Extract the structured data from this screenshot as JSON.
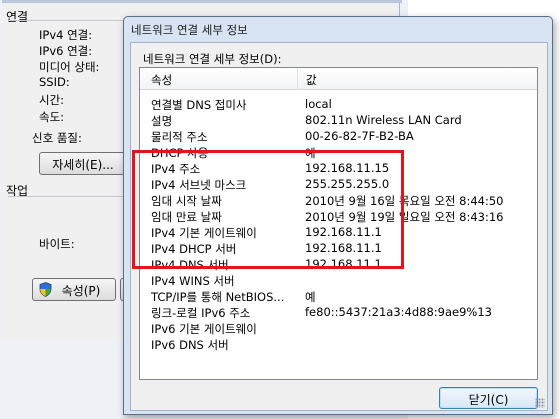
{
  "status_window": {
    "section_connection": "연결",
    "ipv4_label": "IPv4 연결:",
    "ipv6_label": "IPv6 연결:",
    "media_label": "미디어 상태:",
    "ssid_label": "SSID:",
    "time_label": "시간:",
    "speed_label": "속도:",
    "quality_label": "신호 품질:",
    "details_button": "자세히(E)...",
    "section_activity": "작업",
    "bytes_label": "바이트:",
    "properties_button": "속성(P)"
  },
  "dialog": {
    "title": "네트워크 연결 세부 정보",
    "caption": "네트워크 연결 세부 정보(D):",
    "header_property": "속성",
    "header_value": "값",
    "rows": [
      {
        "property": "연결별 DNS 접미사",
        "value": "local"
      },
      {
        "property": "설명",
        "value": "802.11n Wireless LAN Card"
      },
      {
        "property": "물리적 주소",
        "value": "00-26-82-7F-B2-BA"
      },
      {
        "property": "DHCP 사용",
        "value": "예"
      },
      {
        "property": "IPv4 주소",
        "value": "192.168.11.15"
      },
      {
        "property": "IPv4 서브넷 마스크",
        "value": "255.255.255.0"
      },
      {
        "property": "임대 시작 날짜",
        "value": "2010년 9월 16일 목요일 오전 8:44:50"
      },
      {
        "property": "임대 만료 날짜",
        "value": "2010년 9월 19일 일요일 오전 8:43:16"
      },
      {
        "property": "IPv4 기본 게이트웨이",
        "value": "192.168.11.1"
      },
      {
        "property": "IPv4 DHCP 서버",
        "value": "192.168.11.1"
      },
      {
        "property": "IPv4 DNS 서버",
        "value": "192.168.11.1"
      },
      {
        "property": "IPv4 WINS 서버",
        "value": ""
      },
      {
        "property": "TCP/IP를 통해 NetBIOS...",
        "value": "예"
      },
      {
        "property": "링크-로컬 IPv6 주소",
        "value": "fe80::5437:21a3:4d88:9ae9%13"
      },
      {
        "property": "IPv6 기본 게이트웨이",
        "value": ""
      },
      {
        "property": "IPv6 DNS 서버",
        "value": ""
      }
    ],
    "close_button": "닫기(C)"
  },
  "colors": {
    "highlight": "#e2141c",
    "dialog_frame": "#d8e4f3"
  }
}
